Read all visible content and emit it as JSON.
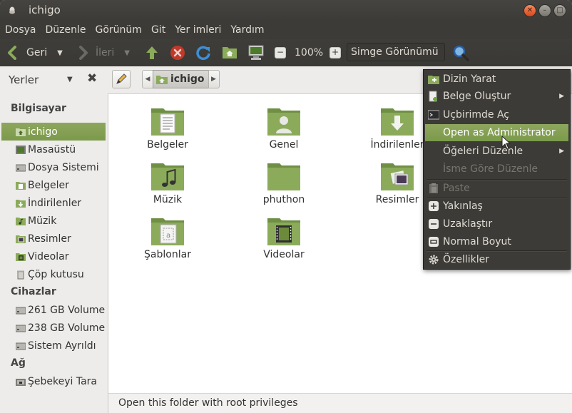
{
  "window": {
    "title": "ichigo"
  },
  "menubar": [
    "Dosya",
    "Düzenle",
    "Görünüm",
    "Git",
    "Yer imleri",
    "Yardım"
  ],
  "toolbar": {
    "back_label": "Geri",
    "forward_label": "İleri",
    "zoom_level": "100%",
    "view_mode": "Simge Görünümü"
  },
  "location": {
    "places_label": "Yerler",
    "current_folder": "ichigo"
  },
  "sidebar": {
    "sections": [
      {
        "title": "Bilgisayar",
        "items": [
          "ichigo",
          "Masaüstü",
          "Dosya Sistemi",
          "Belgeler",
          "İndirilenler",
          "Müzik",
          "Resimler",
          "Videolar",
          "Çöp kutusu"
        ]
      },
      {
        "title": "Cihazlar",
        "items": [
          "261 GB Volume",
          "238 GB Volume",
          "Sistem Ayrıldı"
        ]
      },
      {
        "title": "Ağ",
        "items": [
          "Şebekeyi Tara"
        ]
      }
    ],
    "selected": "ichigo"
  },
  "files": [
    "Belgeler",
    "Genel",
    "İndirilenler",
    "Müzik",
    "phuthon",
    "Resimler",
    "Şablonlar",
    "Videolar"
  ],
  "status": "Open this folder with root privileges",
  "context_menu": [
    {
      "label": "Dizin Yarat",
      "icon": "new-folder-icon"
    },
    {
      "label": "Belge Oluştur",
      "icon": "new-document-icon",
      "submenu": true
    },
    {
      "label": "Uçbirimde Aç",
      "icon": "terminal-icon"
    },
    {
      "label": "Open as Administrator",
      "icon": "",
      "highlighted": true
    },
    {
      "label": "Öğeleri Düzenle",
      "icon": "",
      "submenu": true
    },
    {
      "label": "İsme Göre Düzenle",
      "icon": "",
      "disabled": true
    },
    {
      "label": "Paste",
      "icon": "paste-icon",
      "disabled": true
    },
    {
      "label": "Yakınlaş",
      "icon": "zoom-in-icon"
    },
    {
      "label": "Uzaklaştır",
      "icon": "zoom-out-icon"
    },
    {
      "label": "Normal Boyut",
      "icon": "zoom-normal-icon"
    },
    {
      "label": "Özellikler",
      "icon": "properties-icon"
    }
  ],
  "colors": {
    "accent": "#7b9a4a",
    "titlebar": "#3c3b37",
    "close_button": "#e05a2b",
    "folder": "#8bab5a"
  }
}
